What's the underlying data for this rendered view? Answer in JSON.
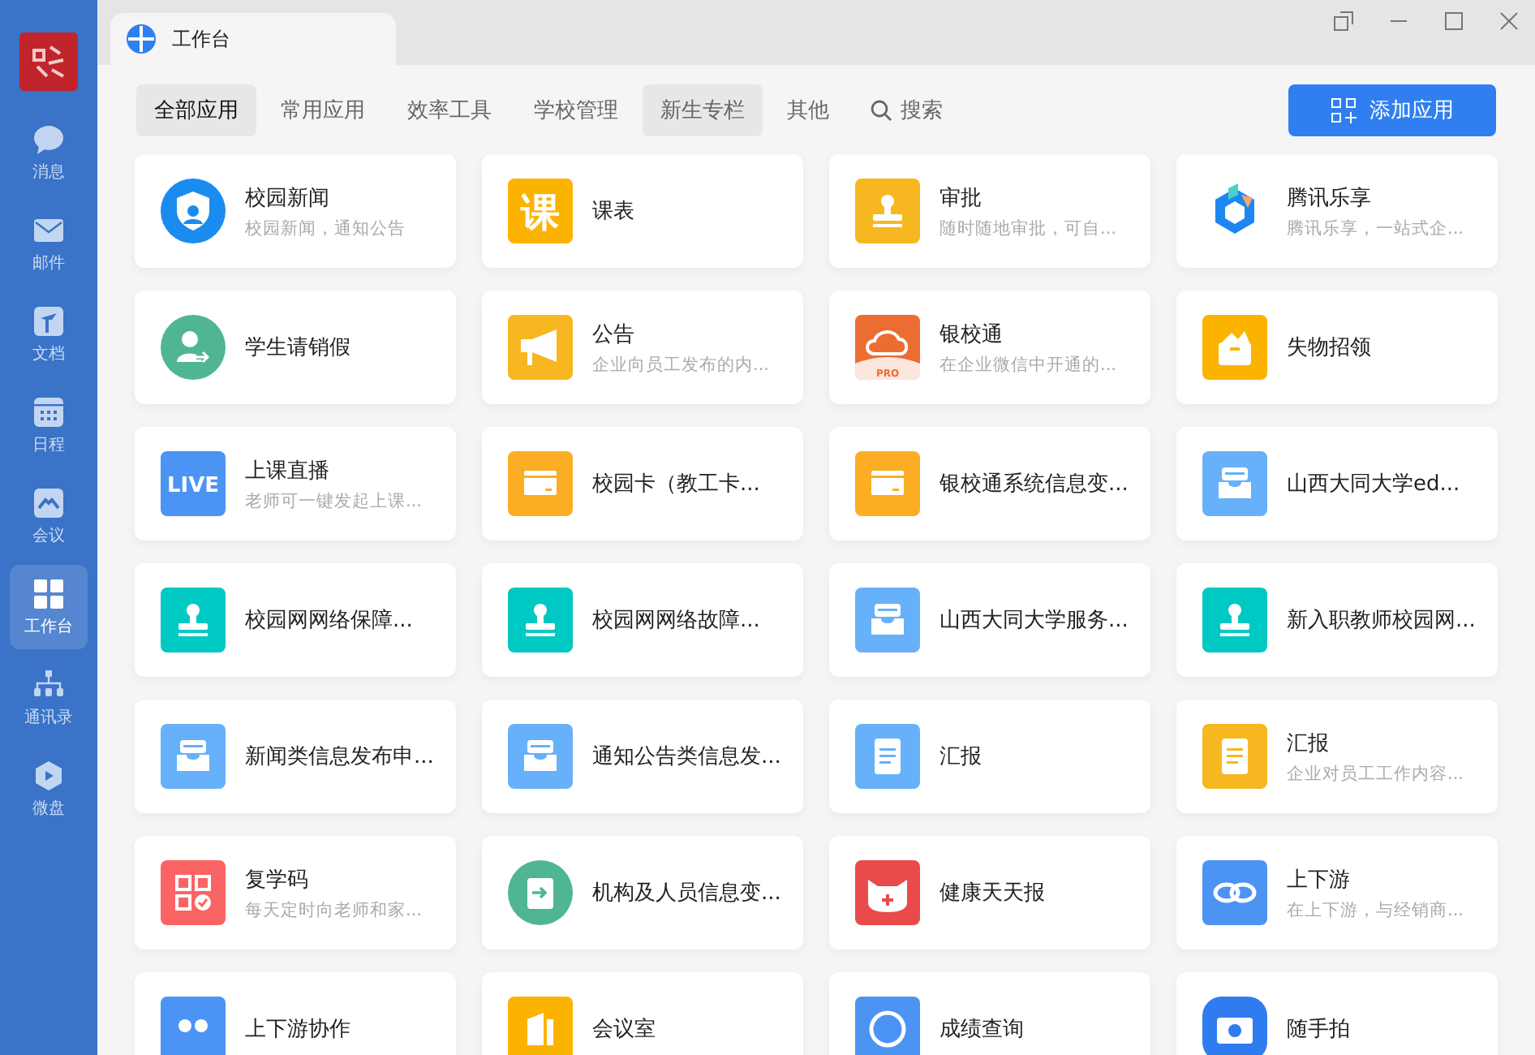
{
  "sidebar": {
    "items": [
      {
        "label": "消息",
        "kind": "chat",
        "selected": false
      },
      {
        "label": "邮件",
        "kind": "mail",
        "selected": false
      },
      {
        "label": "文档",
        "kind": "doc",
        "selected": false
      },
      {
        "label": "日程",
        "kind": "calendar",
        "selected": false
      },
      {
        "label": "会议",
        "kind": "meeting",
        "selected": false
      },
      {
        "label": "工作台",
        "kind": "grid",
        "selected": true
      },
      {
        "label": "通讯录",
        "kind": "org",
        "selected": false
      },
      {
        "label": "微盘",
        "kind": "drive",
        "selected": false
      }
    ]
  },
  "tab": {
    "title": "工作台"
  },
  "filters": [
    {
      "label": "全部应用",
      "selected": true,
      "hovered": false
    },
    {
      "label": "常用应用",
      "selected": false,
      "hovered": false
    },
    {
      "label": "效率工具",
      "selected": false,
      "hovered": false
    },
    {
      "label": "学校管理",
      "selected": false,
      "hovered": false
    },
    {
      "label": "新生专栏",
      "selected": false,
      "hovered": true
    },
    {
      "label": "其他",
      "selected": false,
      "hovered": false
    }
  ],
  "search": {
    "label": "搜索"
  },
  "add_button": {
    "label": "添加应用"
  },
  "apps": [
    {
      "title": "校园新闻",
      "subtitle": "校园新闻，通知公告",
      "kind": "shield",
      "color": "#1a8cf0"
    },
    {
      "title": "课表",
      "kind": "text",
      "icon_text": "课",
      "color": "#fbb300"
    },
    {
      "title": "审批",
      "subtitle": "随时随地审批，可自...",
      "kind": "stamp",
      "color": "#f7b720"
    },
    {
      "title": "腾讯乐享",
      "subtitle": "腾讯乐享，一站式企...",
      "kind": "cube",
      "color": "#1c87f0"
    },
    {
      "title": "学生请销假",
      "kind": "user-arrow",
      "color": "#4fb595"
    },
    {
      "title": "公告",
      "subtitle": "企业向员工发布的内...",
      "kind": "megaphone",
      "color": "#f7b720"
    },
    {
      "title": "银校通",
      "subtitle": "在企业微信中开通的...",
      "kind": "cloud",
      "icon_text": "PRO",
      "color": "#ec6d32"
    },
    {
      "title": "失物招领",
      "kind": "box",
      "color": "#fbb300"
    },
    {
      "title": "上课直播",
      "subtitle": "老师可一键发起上课...",
      "kind": "text",
      "icon_text": "LIVE",
      "color": "#4c94f3"
    },
    {
      "title": "校园卡（教工卡...",
      "kind": "card",
      "color": "#fbad24"
    },
    {
      "title": "银校通系统信息变...",
      "kind": "card",
      "color": "#fbad24"
    },
    {
      "title": "山西大同大学ed...",
      "kind": "tray",
      "color": "#66b1fa"
    },
    {
      "title": "校园网网络保障...",
      "kind": "stamp",
      "color": "#00c8c3"
    },
    {
      "title": "校园网网络故障...",
      "kind": "stamp",
      "color": "#00c8c3"
    },
    {
      "title": "山西大同大学服务...",
      "kind": "tray",
      "color": "#66b1fa"
    },
    {
      "title": "新入职教师校园网...",
      "kind": "stamp",
      "color": "#00c8c3"
    },
    {
      "title": "新闻类信息发布申...",
      "kind": "tray",
      "color": "#66b1fa"
    },
    {
      "title": "通知公告类信息发...",
      "kind": "tray",
      "color": "#66b1fa"
    },
    {
      "title": "汇报",
      "kind": "doc",
      "color": "#66b1fa"
    },
    {
      "title": "汇报",
      "subtitle": "企业对员工工作内容...",
      "kind": "doc",
      "color": "#f7b720"
    },
    {
      "title": "复学码",
      "subtitle": "每天定时向老师和家...",
      "kind": "qr",
      "color": "#fb6464"
    },
    {
      "title": "机构及人员信息变...",
      "kind": "book",
      "color": "#4fb595"
    },
    {
      "title": "健康天天报",
      "kind": "cat",
      "color": "#e94b4b"
    },
    {
      "title": "上下游",
      "subtitle": "在上下游，与经销商...",
      "kind": "link",
      "color": "#4c94f3"
    },
    {
      "title": "上下游协作",
      "kind": "people",
      "color": "#4c94f3"
    },
    {
      "title": "会议室",
      "kind": "flag",
      "color": "#fbb300"
    },
    {
      "title": "成绩查询",
      "kind": "compass",
      "color": "#4c94f3"
    },
    {
      "title": "随手拍",
      "kind": "camera",
      "color": "#2f7cf0"
    }
  ]
}
